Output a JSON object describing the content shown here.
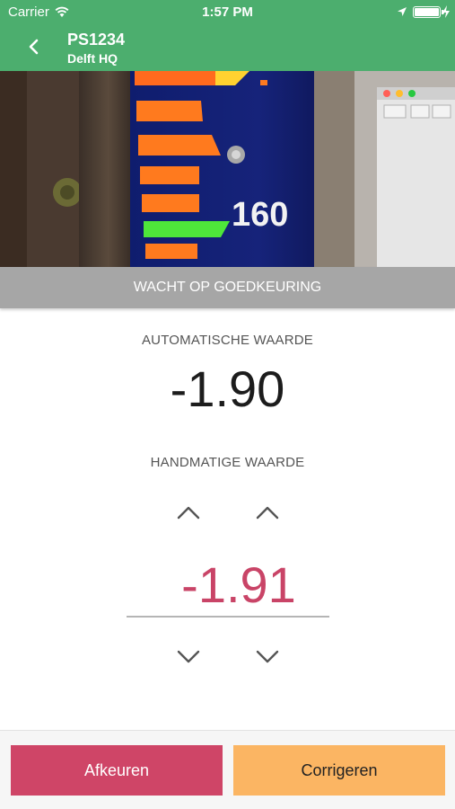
{
  "status_bar": {
    "carrier": "Carrier",
    "time": "1:57 PM",
    "icons": [
      "wifi-icon",
      "location-arrow-icon",
      "battery-icon",
      "charging-bolt-icon"
    ]
  },
  "nav": {
    "title": "PS1234",
    "subtitle": "Delft HQ",
    "back_icon": "chevron-left-icon"
  },
  "photo": {
    "gauge_number": "160",
    "description_icon": "camera-photo"
  },
  "status_banner": "WACHT OP GOEDKEURING",
  "automatic": {
    "label": "AUTOMATISCHE WAARDE",
    "value": "-1.90"
  },
  "manual": {
    "label": "HANDMATIGE WAARDE",
    "value": "-1.91",
    "increment_icons": [
      "chevron-up-icon",
      "chevron-up-icon"
    ],
    "decrement_icons": [
      "chevron-down-icon",
      "chevron-down-icon"
    ]
  },
  "actions": {
    "reject_label": "Afkeuren",
    "correct_label": "Corrigeren"
  },
  "colors": {
    "header_green": "#4cae6e",
    "banner_gray": "#a6a6a6",
    "manual_value": "#c94467",
    "reject_button": "#cf4567",
    "correct_button": "#fbb563"
  }
}
